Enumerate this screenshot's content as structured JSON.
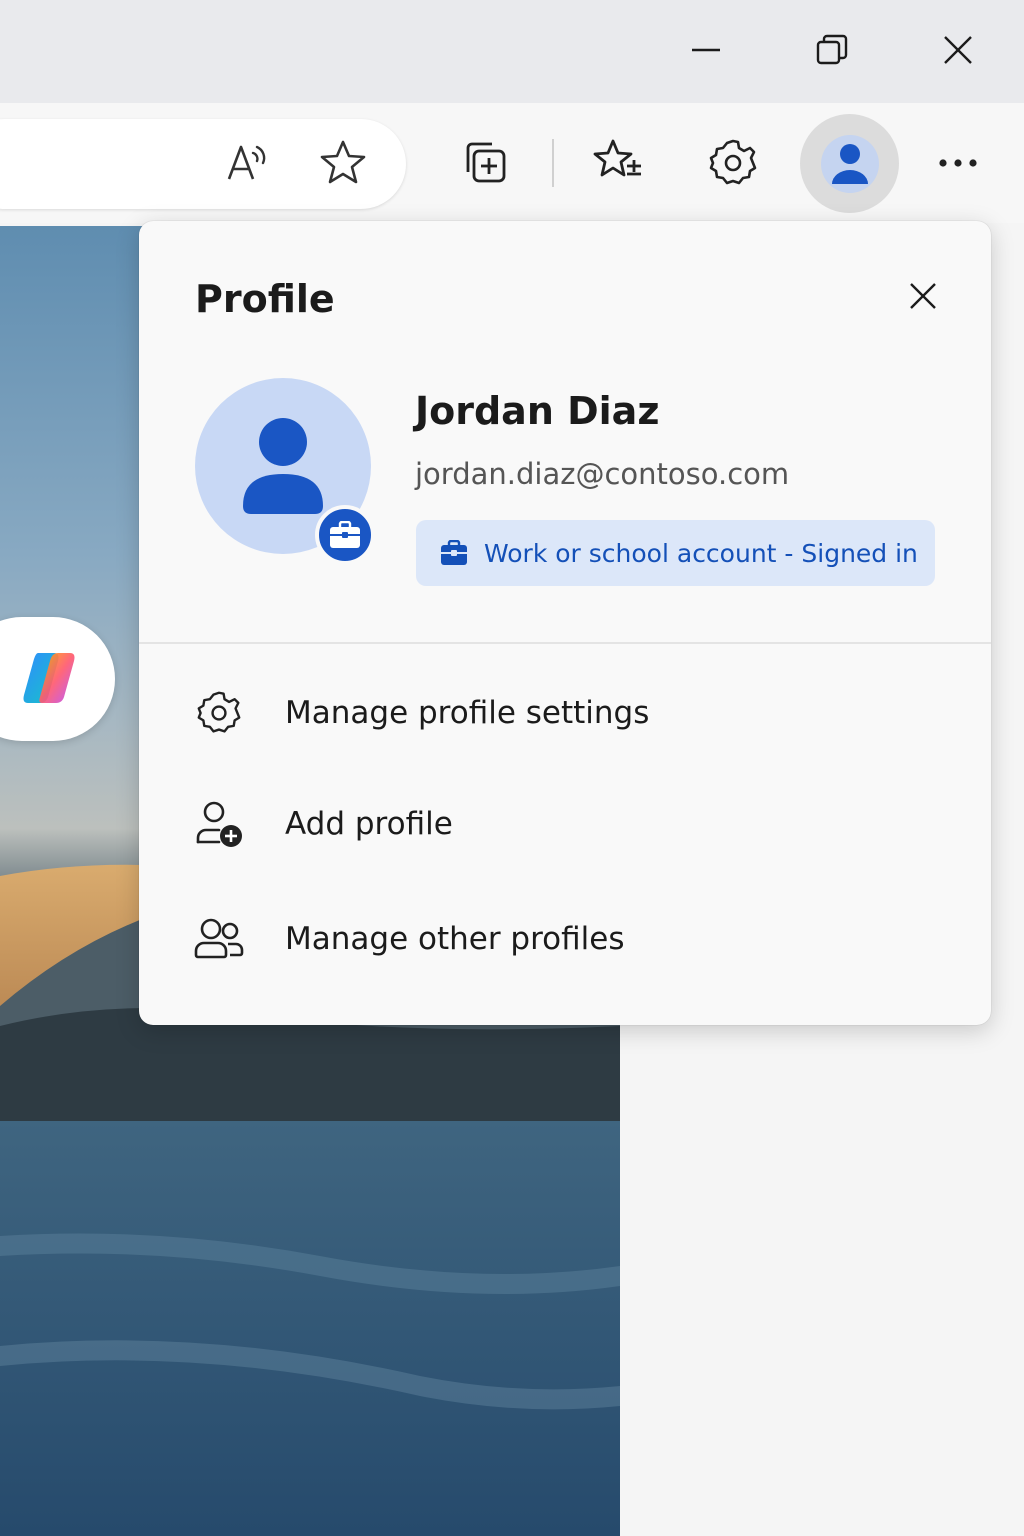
{
  "window": {
    "minimize_icon": "minimize-icon",
    "restore_icon": "restore-icon",
    "close_icon": "close-icon"
  },
  "toolbar": {
    "read_aloud_icon": "read-aloud-icon",
    "favorite_icon": "star-icon",
    "collections_icon": "collections-icon",
    "favorites_icon": "favorites-icon",
    "settings_icon": "gear-icon",
    "profile_icon": "person-icon",
    "more_icon": "more-icon"
  },
  "sidebar": {
    "copilot_icon": "copilot-icon"
  },
  "profile_flyout": {
    "title": "Profile",
    "user": {
      "name": "Jordan Diaz",
      "email": "jordan.diaz@contoso.com"
    },
    "account_status": "Work or school account - Signed in",
    "menu": [
      {
        "label": "Manage profile settings",
        "icon": "gear-icon"
      },
      {
        "label": "Add profile",
        "icon": "add-person-icon"
      },
      {
        "label": "Manage other profiles",
        "icon": "people-icon"
      }
    ]
  },
  "colors": {
    "accent": "#1a56c4",
    "account_pill_bg": "#dce7f9",
    "avatar_bg": "#c8d8f5",
    "titlebar_bg": "#e9eaed"
  }
}
